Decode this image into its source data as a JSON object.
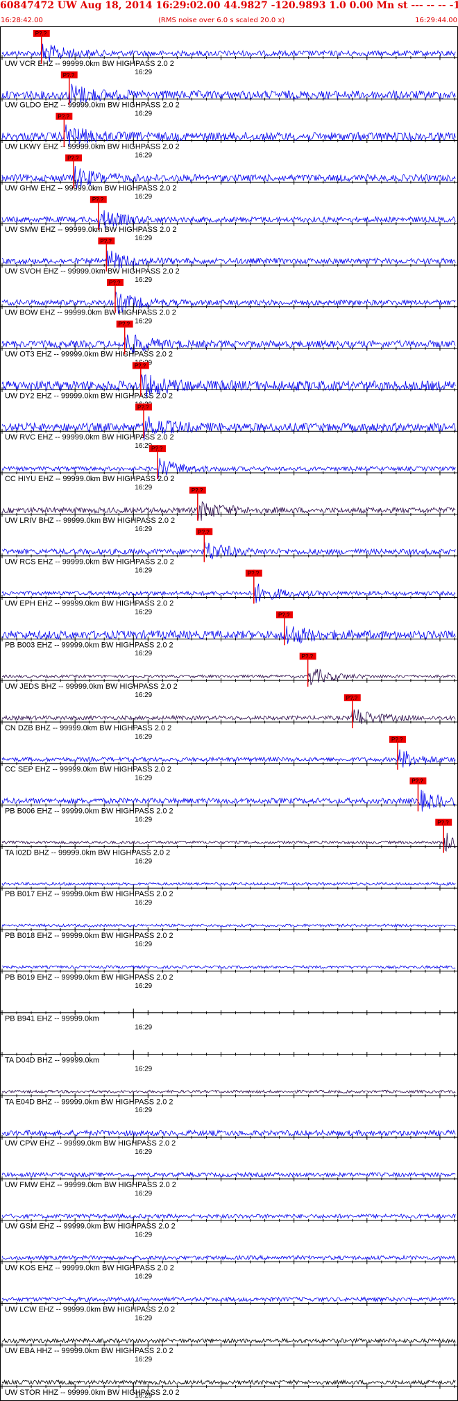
{
  "header": {
    "title": "60847472 UW Aug 18, 2014 16:29:02.00   44.9827 -120.9893  1.0 0.00 Mn st --- -- --   -1",
    "start_time": "16:28:42.00",
    "end_time": "16:29:44.00",
    "rms_note": "(RMS noise over 6.0 s scaled 20.0 x)"
  },
  "colors": {
    "trace_blue": "#0000ee",
    "trace_dark": "#2a0a4a",
    "trace_black": "#000000",
    "pick_red": "#ee0000",
    "axis": "#000000"
  },
  "chart_data": {
    "type": "seismogram",
    "time_tick_label": "16:29",
    "x_range_seconds": [
      0,
      62
    ],
    "pick_label": "P?.?",
    "traces": [
      {
        "label": "UW VCR EHZ -- 99999.0km BW  HIGHPASS  2.0  2",
        "pick_s": 5.4,
        "color": "blue",
        "amp": 4
      },
      {
        "label": "UW GLDO EHZ -- 99999.0km BW  HIGHPASS  2.0  2",
        "pick_s": 9.2,
        "color": "blue",
        "amp": 6
      },
      {
        "label": "UW LKWY EHZ -- 99999.0km BW  HIGHPASS  2.0  2",
        "pick_s": 8.5,
        "color": "blue",
        "amp": 6
      },
      {
        "label": "UW GHW EHZ -- 99999.0km BW  HIGHPASS  2.0  2",
        "pick_s": 9.8,
        "color": "blue",
        "amp": 5
      },
      {
        "label": "UW SMW EHZ -- 99999.0km BW  HIGHPASS  2.0  2",
        "pick_s": 13.2,
        "color": "blue",
        "amp": 4
      },
      {
        "label": "UW SVOH EHZ -- 99999.0km BW  HIGHPASS  2.0  2",
        "pick_s": 14.3,
        "color": "blue",
        "amp": 4
      },
      {
        "label": "UW BOW EHZ -- 99999.0km BW  HIGHPASS  2.0  2",
        "pick_s": 15.5,
        "color": "blue",
        "amp": 4
      },
      {
        "label": "UW OT3 EHZ -- 99999.0km BW  HIGHPASS  2.0  2",
        "pick_s": 16.8,
        "color": "blue",
        "amp": 5
      },
      {
        "label": "UW DY2 EHZ -- 99999.0km BW  HIGHPASS  2.0  2",
        "pick_s": 19.0,
        "color": "blue",
        "amp": 7
      },
      {
        "label": "UW RVC EHZ -- 99999.0km BW  HIGHPASS  2.0  2",
        "pick_s": 19.4,
        "color": "blue",
        "amp": 6
      },
      {
        "label": "CC HIYU EHZ -- 99999.0km BW  HIGHPASS  2.0  2",
        "pick_s": 21.3,
        "color": "blue",
        "amp": 3
      },
      {
        "label": "UW LRIV BHZ -- 99999.0km BW  HIGHPASS  2.0  2",
        "pick_s": 26.8,
        "color": "dark",
        "amp": 4
      },
      {
        "label": "UW RCS EHZ -- 99999.0km BW  HIGHPASS  2.0  2",
        "pick_s": 27.7,
        "color": "blue",
        "amp": 4
      },
      {
        "label": "UW EPH EHZ -- 99999.0km BW  HIGHPASS  2.0  2",
        "pick_s": 34.5,
        "color": "blue",
        "amp": 3
      },
      {
        "label": "PB B003 EHZ -- 99999.0km BW  HIGHPASS  2.0  2",
        "pick_s": 38.7,
        "color": "blue",
        "amp": 6
      },
      {
        "label": "UW JEDS BHZ -- 99999.0km BW  HIGHPASS  2.0  2",
        "pick_s": 41.9,
        "color": "dark",
        "amp": 2
      },
      {
        "label": "CN DZB BHZ -- 99999.0km BW  HIGHPASS  2.0  2",
        "pick_s": 48.0,
        "color": "dark",
        "amp": 3
      },
      {
        "label": "CC SEP EHZ -- 99999.0km BW  HIGHPASS  2.0  2",
        "pick_s": 54.2,
        "color": "blue",
        "amp": 3
      },
      {
        "label": "PB B006 EHZ -- 99999.0km BW  HIGHPASS  2.0  2",
        "pick_s": 57.0,
        "color": "blue",
        "amp": 4
      },
      {
        "label": "TA I02D BHZ -- 99999.0km BW  HIGHPASS  2.0  2",
        "pick_s": 60.5,
        "color": "dark",
        "amp": 2
      },
      {
        "label": "PB B017 EHZ -- 99999.0km BW  HIGHPASS  2.0  2",
        "pick_s": null,
        "color": "blue",
        "amp": 2
      },
      {
        "label": "PB B018 EHZ -- 99999.0km BW  HIGHPASS  2.0  2",
        "pick_s": null,
        "color": "blue",
        "amp": 2
      },
      {
        "label": "PB B019 EHZ -- 99999.0km BW  HIGHPASS  2.0  2",
        "pick_s": null,
        "color": "blue",
        "amp": 2
      },
      {
        "label": "PB B941 EHZ -- 99999.0km",
        "pick_s": null,
        "color": "none",
        "amp": 0
      },
      {
        "label": "TA D04D BHZ -- 99999.0km",
        "pick_s": null,
        "color": "none",
        "amp": 0
      },
      {
        "label": "TA E04D BHZ -- 99999.0km BW  HIGHPASS  2.0  2",
        "pick_s": null,
        "color": "dark",
        "amp": 2
      },
      {
        "label": "UW CPW EHZ -- 99999.0km BW  HIGHPASS  2.0  2",
        "pick_s": null,
        "color": "blue",
        "amp": 4
      },
      {
        "label": "UW FMW EHZ -- 99999.0km BW  HIGHPASS  2.0  2",
        "pick_s": null,
        "color": "blue",
        "amp": 3
      },
      {
        "label": "UW GSM EHZ -- 99999.0km BW  HIGHPASS  2.0  2",
        "pick_s": null,
        "color": "blue",
        "amp": 3
      },
      {
        "label": "UW KOS EHZ -- 99999.0km BW  HIGHPASS  2.0  2",
        "pick_s": null,
        "color": "blue",
        "amp": 3
      },
      {
        "label": "UW LCW EHZ -- 99999.0km BW  HIGHPASS  2.0  2",
        "pick_s": null,
        "color": "blue",
        "amp": 3
      },
      {
        "label": "UW EBA HHZ -- 99999.0km BW  HIGHPASS  2.0  2",
        "pick_s": null,
        "color": "black",
        "amp": 3
      },
      {
        "label": "UW STOR HHZ -- 99999.0km BW  HIGHPASS  2.0  2",
        "pick_s": null,
        "color": "black",
        "amp": 3
      }
    ]
  }
}
